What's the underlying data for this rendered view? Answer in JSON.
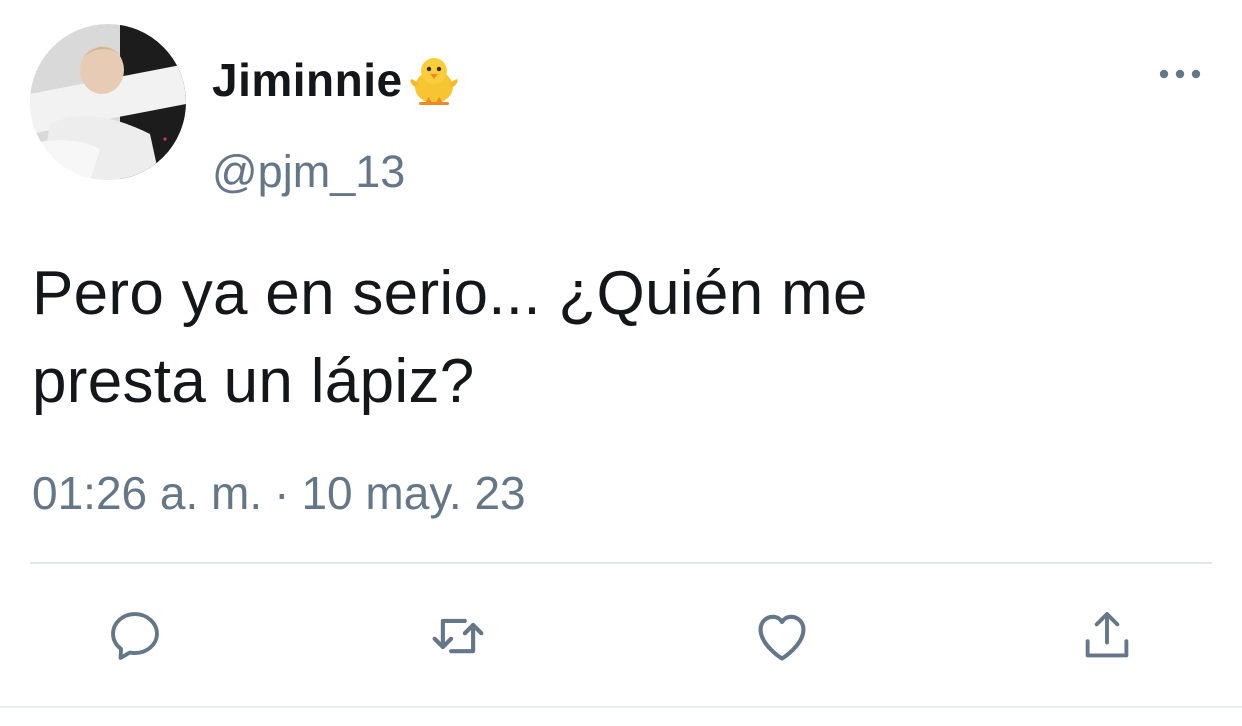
{
  "tweet": {
    "author": {
      "display_name": "Jiminnie",
      "name_emoji": "hatching-chick-emoji",
      "handle": "@pjm_13",
      "avatar_icon": "profile-photo"
    },
    "text": "Pero ya en serio... ¿Quién me\npresta un lápiz?",
    "time": "01:26 a. m.",
    "separator": "·",
    "date": "10 may. 23"
  },
  "actions": {
    "reply_icon": "reply-icon",
    "retweet_icon": "retweet-icon",
    "like_icon": "heart-icon",
    "share_icon": "share-icon",
    "more_icon": "more-dots-icon"
  },
  "colors": {
    "text_primary": "#14171a",
    "text_secondary": "#657786",
    "divider": "#e1e8ed"
  }
}
